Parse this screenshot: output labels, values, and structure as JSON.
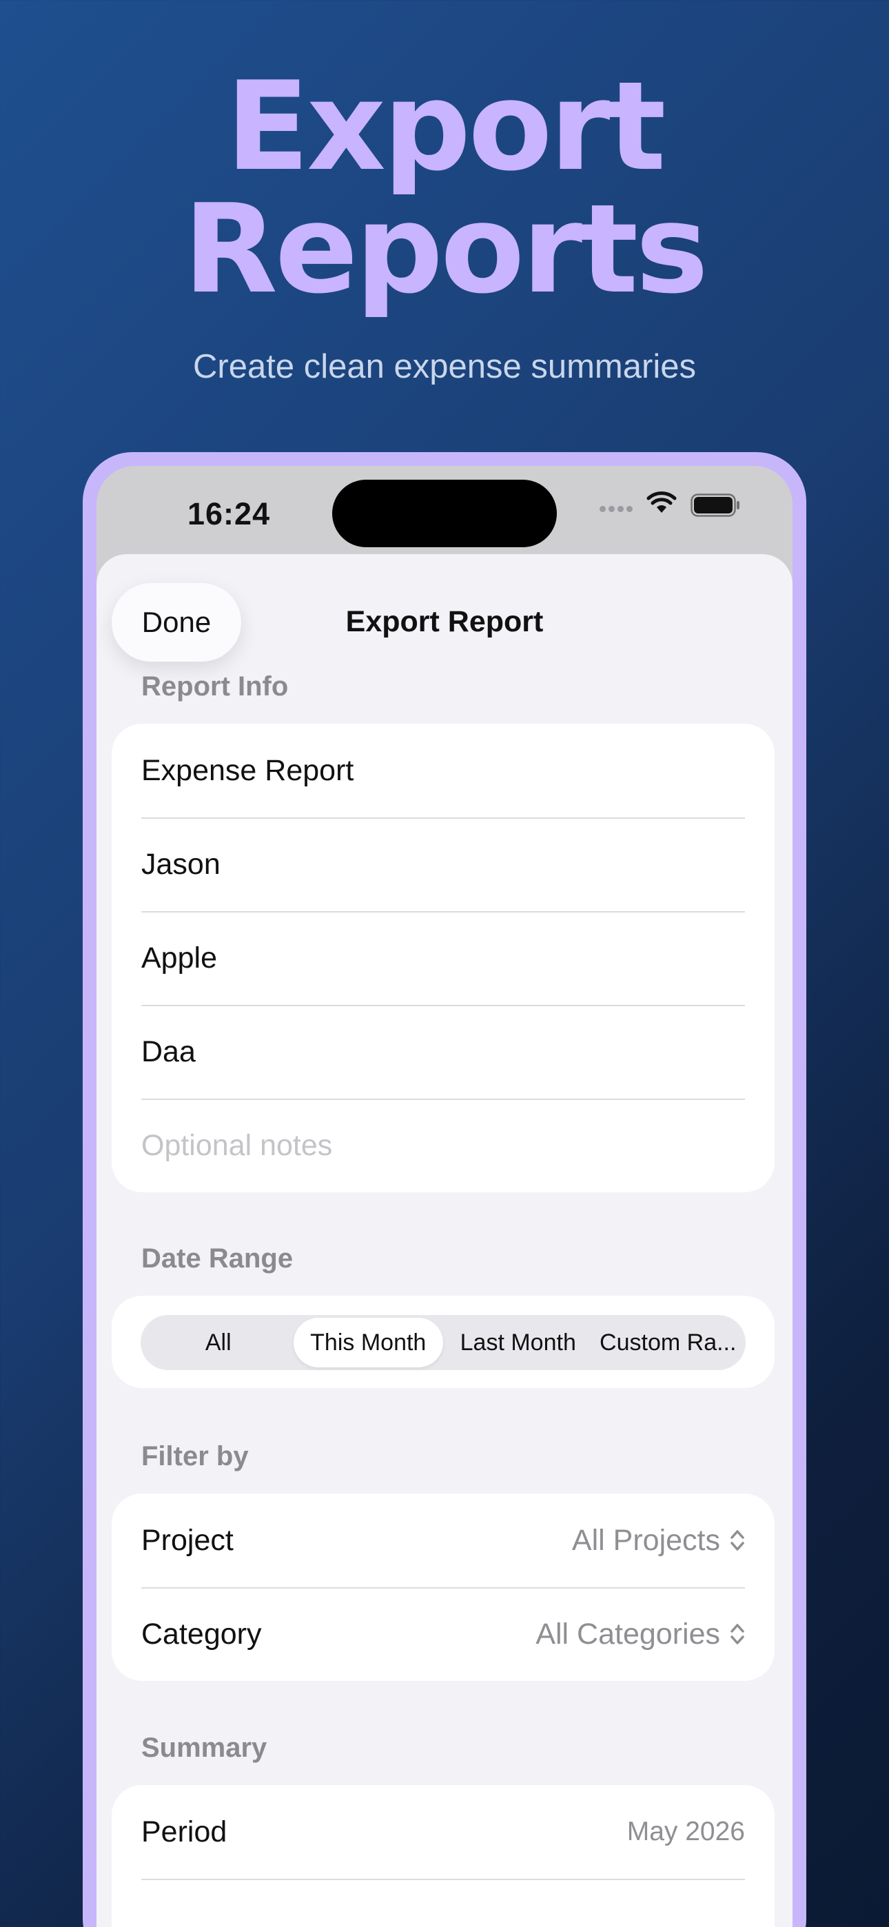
{
  "promo": {
    "headline_line1": "Export",
    "headline_line2": "Reports",
    "subtitle": "Create clean expense summaries",
    "accent_color": "#c8b4ff"
  },
  "status_bar": {
    "time": "16:24"
  },
  "sheet": {
    "title": "Export Report",
    "done_label": "Done"
  },
  "report_info": {
    "header": "Report Info",
    "fields": [
      {
        "value": "Expense Report",
        "placeholder": ""
      },
      {
        "value": "Jason",
        "placeholder": ""
      },
      {
        "value": "Apple",
        "placeholder": ""
      },
      {
        "value": "Daa",
        "placeholder": ""
      },
      {
        "value": "",
        "placeholder": "Optional notes"
      }
    ]
  },
  "date_range": {
    "header": "Date Range",
    "options": [
      "All",
      "This Month",
      "Last Month",
      "Custom Ra..."
    ],
    "selected": "This Month"
  },
  "filter": {
    "header": "Filter by",
    "project_label": "Project",
    "project_value": "All Projects",
    "category_label": "Category",
    "category_value": "All Categories"
  },
  "summary": {
    "header": "Summary",
    "period_label": "Period",
    "period_value": "May 2026"
  }
}
